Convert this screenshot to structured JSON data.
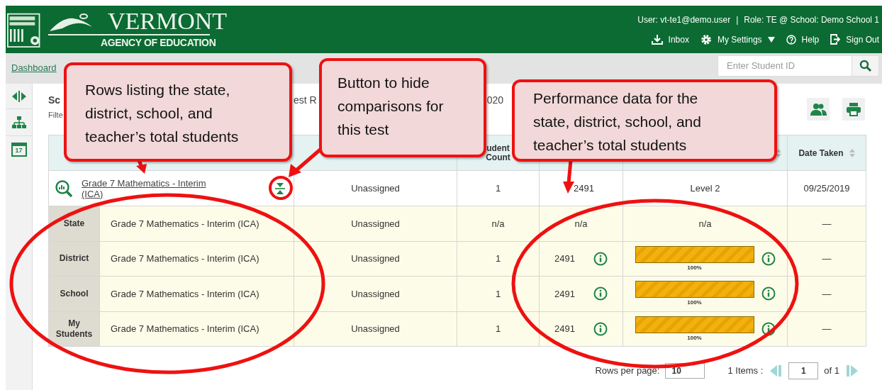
{
  "header": {
    "logo_title": "VERMONT",
    "logo_subtitle": "AGENCY OF EDUCATION",
    "user": "User: vt-te1@demo.user",
    "separator": "|",
    "role": "Role: TE @ School: Demo School 1",
    "nav": [
      {
        "kind": "inbox",
        "label": "Inbox",
        "dropdown": false
      },
      {
        "kind": "settings",
        "label": "My Settings",
        "dropdown": true
      },
      {
        "kind": "help",
        "label": "Help",
        "dropdown": false
      },
      {
        "kind": "signout",
        "label": "Sign Out",
        "dropdown": false
      }
    ]
  },
  "breadcrumb": {
    "link": "Dashboard",
    "search_placeholder": "Enter Student ID"
  },
  "sidebar": {
    "calendar_day": "17"
  },
  "report": {
    "title_start": "Sc",
    "title_middle": "est R",
    "title_end": "020",
    "filter_start": "Filte"
  },
  "table": {
    "header_count": "udent Count",
    "header_date": "Date Taken",
    "test_row": {
      "test": "Grade 7 Mathematics - Interim (ICA)",
      "assignment": "Unassigned",
      "count": "1",
      "score": "2491",
      "level": "Level 2",
      "date": "09/25/2019"
    },
    "comparison_rows": [
      {
        "group": "State",
        "test": "Grade 7 Mathematics - Interim (ICA)",
        "assignment": "Unassigned",
        "count": "n/a",
        "kind": "na",
        "score": "n/a",
        "level_text": "n/a",
        "date": "—"
      },
      {
        "group": "District",
        "test": "Grade 7 Mathematics - Interim (ICA)",
        "assignment": "Unassigned",
        "count": "1",
        "kind": "bar",
        "score": "2491",
        "level": 1,
        "bar_label": "100%",
        "date": "—"
      },
      {
        "group": "School",
        "test": "Grade 7 Mathematics - Interim (ICA)",
        "assignment": "Unassigned",
        "count": "1",
        "kind": "bar",
        "score": "2491",
        "level": 1,
        "bar_label": "100%",
        "date": "—"
      },
      {
        "group": "My Students",
        "test": "Grade 7 Mathematics - Interim (ICA)",
        "assignment": "Unassigned",
        "count": "1",
        "kind": "bar",
        "score": "2491",
        "level": 1,
        "bar_label": "100%",
        "date": "—"
      }
    ]
  },
  "pagination": {
    "rows_label": "Rows per page:",
    "rows_value": "10",
    "items": "1 Items :",
    "page": "1",
    "of": "of 1"
  },
  "callouts": [
    {
      "text": "Rows listing the state, district, school, and teacher’s total students"
    },
    {
      "text": "Button to hide comparisons for this test"
    },
    {
      "text": "Performance data for the state, district, school, and teacher’s total students"
    }
  ]
}
